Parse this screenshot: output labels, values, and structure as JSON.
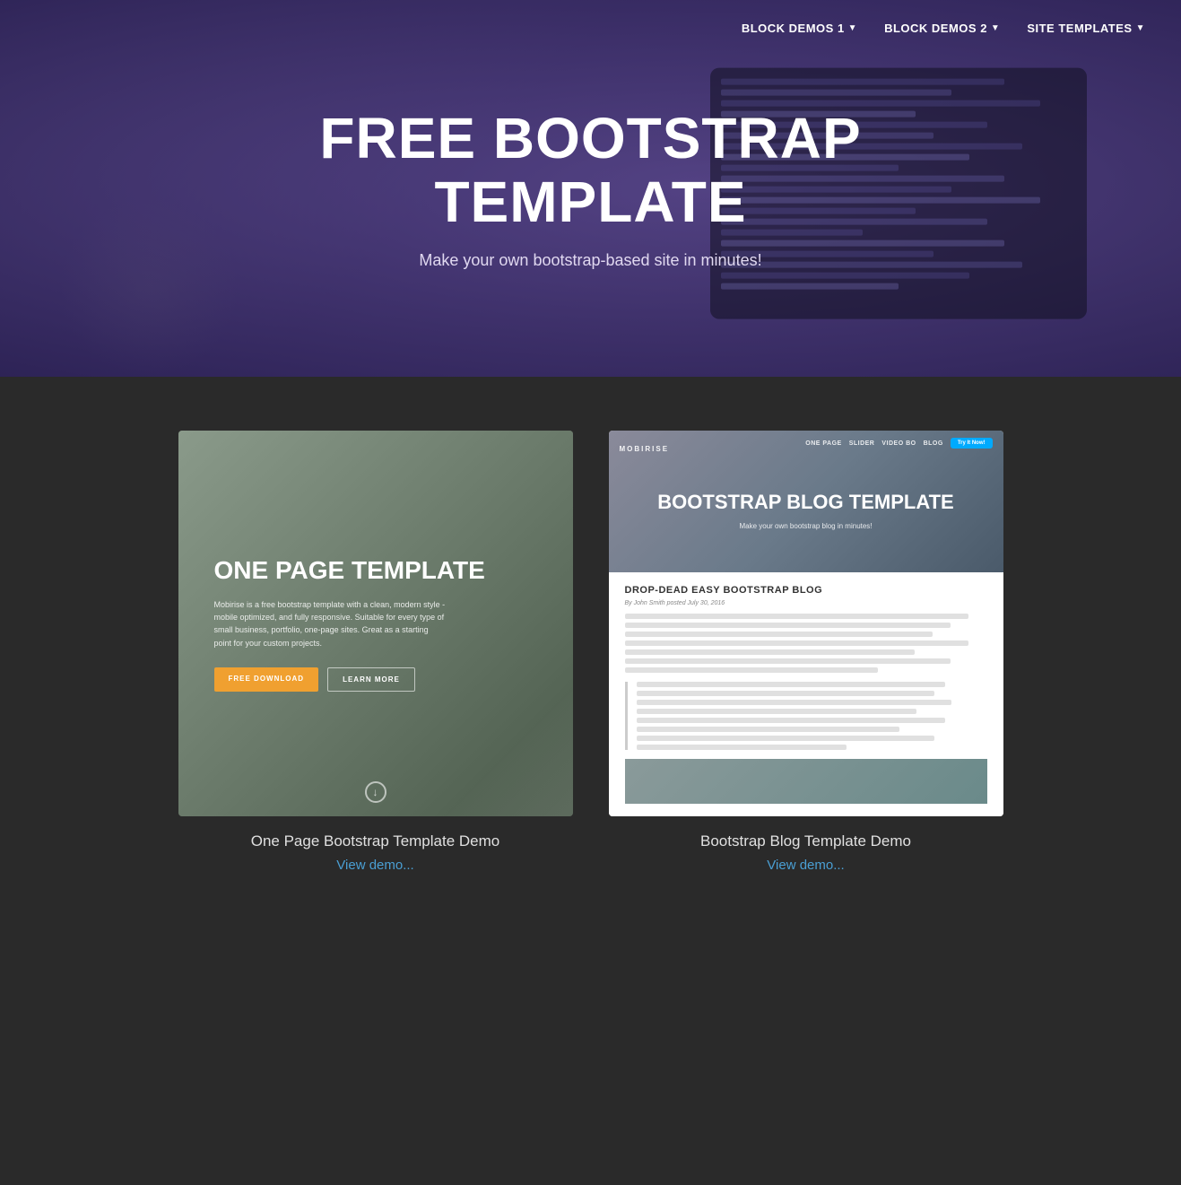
{
  "nav": {
    "items": [
      {
        "label": "BLOCK DEMOS 1",
        "hasDropdown": true
      },
      {
        "label": "BLOCK DEMOS 2",
        "hasDropdown": true
      },
      {
        "label": "SITE TEMPLATES",
        "hasDropdown": true
      }
    ]
  },
  "hero": {
    "title": "FREE BOOTSTRAP TEMPLATE",
    "subtitle": "Make your own bootstrap-based site in minutes!"
  },
  "templates": [
    {
      "id": "one-page",
      "preview": {
        "title": "ONE PAGE TEMPLATE",
        "description": "Mobirise is a free bootstrap template with a clean, modern style - mobile optimized, and fully responsive. Suitable for every type of small business, portfolio, one-page sites. Great as a starting point for your custom projects.",
        "btn1": "FREE DOWNLOAD",
        "btn2": "LEARN MORE"
      },
      "name": "One Page Bootstrap Template Demo",
      "link": "View demo..."
    },
    {
      "id": "blog",
      "preview": {
        "brand": "MOBIRISE",
        "navItems": [
          "ONE PAGE",
          "SLIDER",
          "VIDEO BO",
          "BLOG"
        ],
        "cta": "Try It Now!",
        "title": "BOOTSTRAP BLOG TEMPLATE",
        "subtitle": "Make your own bootstrap blog in minutes!",
        "postTitle": "DROP-DEAD EASY BOOTSTRAP BLOG",
        "postMeta": "By John Smith posted July 30, 2016"
      },
      "name": "Bootstrap Blog Template Demo",
      "link": "View demo..."
    }
  ]
}
